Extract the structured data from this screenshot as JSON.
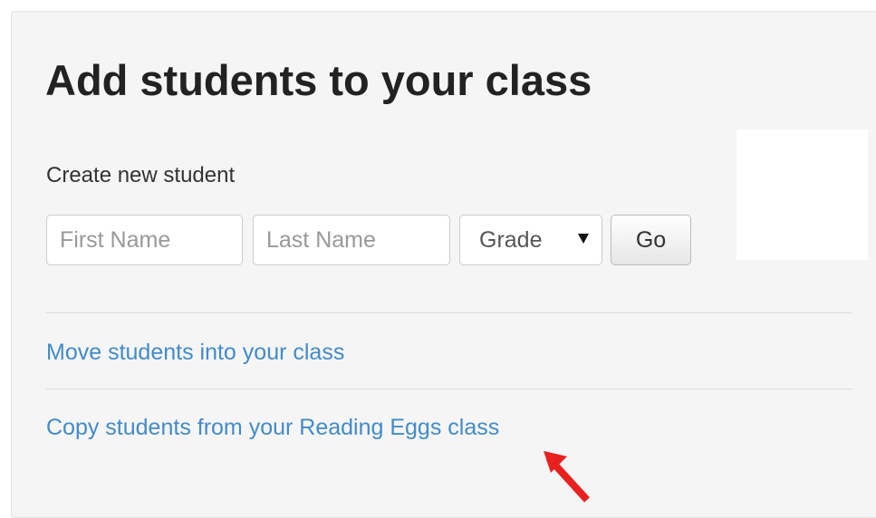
{
  "page": {
    "title": "Add students to your class"
  },
  "create_student": {
    "label": "Create new student",
    "first_name": {
      "placeholder": "First Name",
      "value": ""
    },
    "last_name": {
      "placeholder": "Last Name",
      "value": ""
    },
    "grade": {
      "selected": "Grade"
    },
    "go_label": "Go"
  },
  "links": {
    "move_students": "Move students into your class",
    "copy_students": "Copy students from your Reading Eggs class"
  },
  "colors": {
    "panel_background": "#f5f5f5",
    "link": "#428bca",
    "annotation_arrow": "#e8201e"
  },
  "icons": {
    "select_caret": "caret-down-icon",
    "annotation": "red-arrow-icon"
  }
}
